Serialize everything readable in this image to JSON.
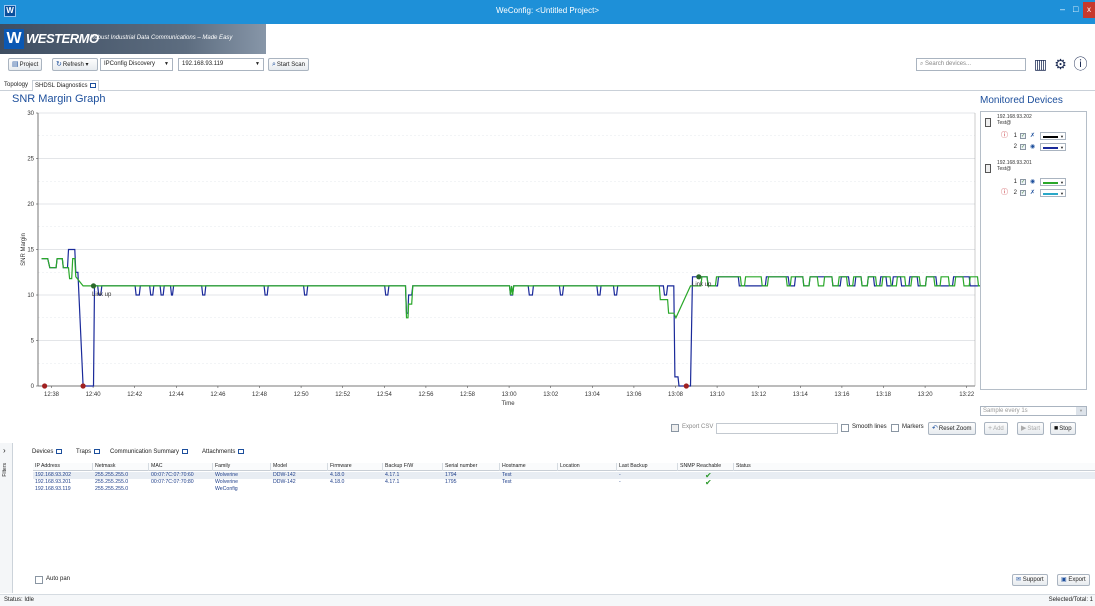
{
  "window": {
    "title": "WeConfig: <Untitled Project>",
    "app_icon": "W",
    "minimize": "–",
    "maximize": "□",
    "close": "x"
  },
  "brand": {
    "logo_mark": "W",
    "logo": "WESTERMO",
    "tagline": "Robust Industrial Data Communications – Made Easy"
  },
  "toolbar": {
    "project": "Project",
    "refresh": "Refresh",
    "discovery": "IPConfig Discovery",
    "ip": "192.168.93.119",
    "start_scan": "Start Scan",
    "search_placeholder": "Search devices..."
  },
  "tabs": [
    {
      "label": "Topology"
    },
    {
      "label": "SHDSL Diagnostics"
    }
  ],
  "graph": {
    "title": "SNR Margin Graph"
  },
  "chart_data": {
    "type": "line",
    "ylabel": "SNR Margin",
    "xlabel": "Time",
    "ylim": [
      0,
      30
    ],
    "yticks": [
      "0",
      "5",
      "10",
      "15",
      "20",
      "25",
      "30"
    ],
    "xticks": [
      "12:38",
      "12:40",
      "12:42",
      "12:44",
      "12:46",
      "12:48",
      "12:50",
      "12:52",
      "12:54",
      "12:56",
      "12:58",
      "13:00",
      "13:02",
      "13:04",
      "13:06",
      "13:08",
      "13:10",
      "13:12",
      "13:14",
      "13:16",
      "13:18",
      "13:20",
      "13:22"
    ],
    "grid": true,
    "annotations": [
      {
        "text": "Link up"
      },
      {
        "text": "Link up"
      }
    ],
    "series": [
      {
        "color": "#1a2a9a",
        "points": [
          [
            0,
            14
          ],
          [
            0.3,
            14
          ],
          [
            0.4,
            13
          ],
          [
            0.7,
            13
          ],
          [
            0.75,
            14
          ],
          [
            1.0,
            14
          ],
          [
            1.05,
            13
          ],
          [
            1.25,
            13
          ],
          [
            1.3,
            15
          ],
          [
            1.6,
            15
          ],
          [
            1.65,
            12.5
          ],
          [
            1.75,
            12.5
          ],
          [
            2.0,
            0
          ],
          [
            2.5,
            0
          ],
          [
            2.55,
            11
          ],
          [
            2.7,
            11
          ],
          [
            2.75,
            10
          ],
          [
            2.85,
            10
          ],
          [
            2.9,
            11
          ],
          [
            4.5,
            11
          ],
          [
            4.55,
            10
          ],
          [
            4.7,
            10
          ],
          [
            4.75,
            11
          ],
          [
            5.2,
            11
          ],
          [
            5.25,
            10
          ],
          [
            5.35,
            10
          ],
          [
            5.4,
            11
          ],
          [
            5.7,
            11
          ],
          [
            5.75,
            10
          ],
          [
            5.85,
            10
          ],
          [
            5.9,
            11
          ],
          [
            6.2,
            11
          ],
          [
            6.25,
            10
          ],
          [
            6.3,
            10
          ],
          [
            6.35,
            11
          ],
          [
            7.7,
            11
          ],
          [
            7.75,
            10
          ],
          [
            7.85,
            10
          ],
          [
            7.9,
            11
          ],
          [
            10.7,
            11
          ],
          [
            10.75,
            10
          ],
          [
            10.85,
            10
          ],
          [
            10.9,
            11
          ],
          [
            12.6,
            11
          ],
          [
            12.65,
            10
          ],
          [
            12.75,
            10
          ],
          [
            12.8,
            11
          ],
          [
            16.5,
            11
          ],
          [
            16.55,
            10
          ],
          [
            16.65,
            10
          ],
          [
            16.7,
            11
          ],
          [
            17.5,
            11
          ],
          [
            17.55,
            8
          ],
          [
            17.62,
            8
          ],
          [
            17.65,
            10
          ],
          [
            17.8,
            10
          ],
          [
            17.85,
            11
          ],
          [
            22.5,
            11
          ],
          [
            22.55,
            10
          ],
          [
            22.65,
            10
          ],
          [
            22.7,
            11
          ],
          [
            23.4,
            11
          ],
          [
            23.45,
            10
          ],
          [
            23.6,
            10
          ],
          [
            23.65,
            11
          ],
          [
            24.9,
            11
          ],
          [
            24.95,
            10
          ],
          [
            25.05,
            10
          ],
          [
            25.1,
            11
          ],
          [
            26.7,
            11
          ],
          [
            26.75,
            10
          ],
          [
            26.85,
            10
          ],
          [
            26.9,
            11
          ],
          [
            27.5,
            11
          ],
          [
            27.55,
            10
          ],
          [
            27.65,
            10
          ],
          [
            27.7,
            11
          ],
          [
            29.9,
            11
          ],
          [
            29.95,
            10
          ],
          [
            30.05,
            10
          ],
          [
            30.1,
            11
          ],
          [
            30.4,
            11
          ],
          [
            30.45,
            1
          ],
          [
            30.6,
            1
          ],
          [
            30.65,
            0
          ],
          [
            31.0,
            0
          ],
          [
            31.2,
            0
          ],
          [
            31.3,
            12
          ],
          [
            32.0,
            12
          ],
          [
            32.05,
            11
          ],
          [
            32.5,
            11
          ],
          [
            32.55,
            12
          ],
          [
            33.5,
            12
          ],
          [
            33.55,
            11
          ],
          [
            34.8,
            11
          ],
          [
            34.85,
            12
          ],
          [
            35.9,
            12
          ],
          [
            35.95,
            11
          ],
          [
            36.2,
            11
          ],
          [
            36.25,
            12
          ],
          [
            36.6,
            12
          ],
          [
            36.65,
            11
          ],
          [
            36.9,
            11
          ],
          [
            36.95,
            12
          ],
          [
            38.0,
            12
          ],
          [
            38.05,
            11
          ],
          [
            38.4,
            11
          ],
          [
            38.45,
            12
          ],
          [
            38.8,
            12
          ],
          [
            38.85,
            11
          ],
          [
            39.1,
            11
          ],
          [
            39.15,
            12
          ],
          [
            39.4,
            12
          ],
          [
            39.45,
            11
          ],
          [
            39.7,
            11
          ],
          [
            39.75,
            12
          ],
          [
            40.0,
            12
          ],
          [
            40.05,
            11
          ],
          [
            40.3,
            11
          ],
          [
            40.35,
            12
          ],
          [
            40.6,
            12
          ],
          [
            40.65,
            11
          ],
          [
            40.9,
            11
          ],
          [
            40.95,
            12
          ],
          [
            41.3,
            12
          ],
          [
            41.35,
            11
          ],
          [
            41.7,
            11
          ],
          [
            41.75,
            12
          ],
          [
            42.1,
            12
          ],
          [
            42.15,
            11
          ],
          [
            42.5,
            11
          ],
          [
            42.55,
            12
          ],
          [
            43.0,
            12
          ],
          [
            43.05,
            11
          ],
          [
            43.8,
            11
          ],
          [
            43.85,
            12
          ],
          [
            44.6,
            12
          ],
          [
            44.65,
            11
          ],
          [
            45.6,
            11
          ],
          [
            45.65,
            12
          ],
          [
            46.0,
            12
          ]
        ]
      },
      {
        "color": "#2aa82a",
        "points": [
          [
            0,
            14
          ],
          [
            0.3,
            14
          ],
          [
            0.4,
            13
          ],
          [
            0.7,
            13
          ],
          [
            0.75,
            14
          ],
          [
            1.0,
            14
          ],
          [
            1.05,
            13
          ],
          [
            1.3,
            13
          ],
          [
            1.35,
            11.8
          ],
          [
            1.45,
            11.8
          ],
          [
            1.5,
            14
          ],
          [
            1.6,
            14
          ],
          [
            1.65,
            12
          ],
          [
            2.0,
            11
          ],
          [
            4.5,
            11
          ],
          [
            17.5,
            11
          ],
          [
            17.55,
            7.5
          ],
          [
            17.62,
            7.5
          ],
          [
            17.65,
            9
          ],
          [
            17.8,
            9
          ],
          [
            17.85,
            11
          ],
          [
            22.5,
            11
          ],
          [
            22.55,
            10
          ],
          [
            22.6,
            11
          ],
          [
            22.65,
            10
          ],
          [
            22.7,
            11
          ],
          [
            28.5,
            11
          ],
          [
            29.7,
            11
          ],
          [
            29.75,
            9.5
          ],
          [
            30.1,
            9.5
          ],
          [
            30.15,
            8
          ],
          [
            30.4,
            8
          ],
          [
            30.5,
            7.5
          ],
          [
            31.2,
            11
          ],
          [
            31.7,
            11
          ],
          [
            31.75,
            12
          ],
          [
            32.0,
            12
          ],
          [
            32.05,
            11
          ],
          [
            32.4,
            11
          ],
          [
            32.45,
            12
          ],
          [
            33.6,
            12
          ],
          [
            33.65,
            11
          ],
          [
            33.8,
            11
          ],
          [
            33.85,
            12
          ],
          [
            34.6,
            12
          ],
          [
            34.65,
            11
          ],
          [
            34.9,
            11
          ],
          [
            34.95,
            12
          ],
          [
            35.8,
            12
          ],
          [
            35.85,
            11
          ],
          [
            36.0,
            11
          ],
          [
            36.05,
            12
          ],
          [
            36.6,
            12
          ],
          [
            36.65,
            11
          ],
          [
            36.9,
            11
          ],
          [
            36.95,
            12
          ],
          [
            37.3,
            12
          ],
          [
            37.35,
            11
          ],
          [
            37.6,
            11
          ],
          [
            37.65,
            12
          ],
          [
            38.0,
            12
          ],
          [
            38.05,
            11
          ],
          [
            38.3,
            11
          ],
          [
            38.35,
            12
          ],
          [
            38.7,
            12
          ],
          [
            38.75,
            11
          ],
          [
            39.0,
            11
          ],
          [
            39.05,
            12
          ],
          [
            39.4,
            12
          ],
          [
            39.45,
            11
          ],
          [
            39.7,
            11
          ],
          [
            39.75,
            12
          ],
          [
            40.1,
            12
          ],
          [
            40.15,
            11
          ],
          [
            40.4,
            11
          ],
          [
            40.45,
            12
          ],
          [
            40.8,
            12
          ],
          [
            40.85,
            11
          ],
          [
            41.1,
            11
          ],
          [
            41.15,
            12
          ],
          [
            41.5,
            12
          ],
          [
            41.55,
            11
          ],
          [
            41.8,
            11
          ],
          [
            41.85,
            12
          ],
          [
            42.2,
            12
          ],
          [
            42.25,
            11
          ],
          [
            42.5,
            11
          ],
          [
            42.55,
            12
          ],
          [
            42.9,
            12
          ],
          [
            42.95,
            11
          ],
          [
            43.2,
            11
          ],
          [
            43.25,
            12
          ],
          [
            43.6,
            12
          ],
          [
            43.65,
            11
          ],
          [
            43.9,
            11
          ],
          [
            43.95,
            12
          ],
          [
            44.3,
            12
          ],
          [
            44.35,
            11
          ],
          [
            44.6,
            11
          ],
          [
            44.65,
            12
          ],
          [
            45.0,
            12
          ],
          [
            45.05,
            11
          ],
          [
            45.3,
            11
          ],
          [
            45.35,
            12
          ],
          [
            45.7,
            12
          ],
          [
            45.75,
            11
          ],
          [
            46.0,
            11
          ]
        ]
      }
    ],
    "markers": [
      {
        "x": 0.15,
        "y": 0,
        "color": "#a02020"
      },
      {
        "x": 2.0,
        "y": 0,
        "color": "#a02020"
      },
      {
        "x": 2.5,
        "y": 11,
        "color": "#2a6a2a"
      },
      {
        "x": 31.0,
        "y": 0,
        "color": "#a02020"
      },
      {
        "x": 31.6,
        "y": 12,
        "color": "#2a6a2a"
      }
    ]
  },
  "monitor": {
    "title": "Monitored Devices",
    "devices": [
      {
        "ip": "192.168.93.202",
        "name": "Test@",
        "ports": [
          {
            "num": "1",
            "warn": true,
            "color": "#000000"
          },
          {
            "num": "2",
            "warn": false,
            "color": "#1a2a9a"
          }
        ]
      },
      {
        "ip": "192.168.93.201",
        "name": "Test@",
        "ports": [
          {
            "num": "1",
            "warn": false,
            "color": "#2aa82a"
          },
          {
            "num": "2",
            "warn": true,
            "color": "#2aa8c8"
          }
        ]
      }
    ],
    "sample": "Sample every 1s",
    "add": "Add",
    "start": "Start",
    "stop": "Stop"
  },
  "controls": {
    "export_csv": "Export CSV",
    "smooth": "Smooth lines",
    "markers": "Markers",
    "reset_zoom": "Reset Zoom"
  },
  "bottom_tabs": [
    {
      "label": "Devices"
    },
    {
      "label": "Traps"
    },
    {
      "label": "Communication Summary"
    },
    {
      "label": "Attachments"
    }
  ],
  "filters": "Filters",
  "table": {
    "columns": [
      "IP Address",
      "Netmask",
      "MAC",
      "Family",
      "Model",
      "Firmware",
      "Backup F/W",
      "Serial number",
      "Hostname",
      "Location",
      "Last Backup",
      "SNMP Reachable",
      "Status"
    ],
    "rows": [
      [
        "192.168.93.202",
        "255.255.255.0",
        "00:07:7C:07:70:60",
        "Wolverine",
        "DDW-142",
        "4.18.0",
        "4.17.1",
        "1794",
        "Test",
        "",
        "-",
        "✔",
        ""
      ],
      [
        "192.168.93.201",
        "255.255.255.0",
        "00:07:7C:07:70:80",
        "Wolverine",
        "DDW-142",
        "4.18.0",
        "4.17.1",
        "1795",
        "Test",
        "",
        "-",
        "✔",
        ""
      ],
      [
        "192.168.93.119",
        "255.255.255.0",
        "",
        "WeConfig",
        "",
        "",
        "",
        "",
        "",
        "",
        "",
        "",
        ""
      ]
    ]
  },
  "footer": {
    "auto_pan": "Auto pan",
    "support": "Support",
    "export": "Export",
    "status": "Status: Idle",
    "selected": "Selected/Total: 1"
  }
}
